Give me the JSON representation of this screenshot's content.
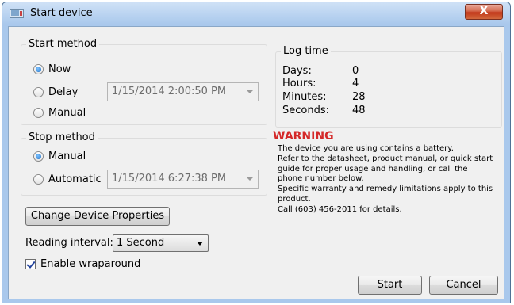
{
  "window": {
    "title": "Start device",
    "close_label": "X"
  },
  "start_method": {
    "group_title": "Start method",
    "now_label": "Now",
    "delay_label": "Delay",
    "manual_label": "Manual",
    "selected": "Now",
    "delay_datetime": "1/15/2014 2:00:50 PM"
  },
  "stop_method": {
    "group_title": "Stop method",
    "manual_label": "Manual",
    "automatic_label": "Automatic",
    "selected": "Manual",
    "automatic_datetime": "1/15/2014 6:27:38 PM"
  },
  "log_time": {
    "group_title": "Log time",
    "days_label": "Days:",
    "days_value": "0",
    "hours_label": "Hours:",
    "hours_value": "4",
    "minutes_label": "Minutes:",
    "minutes_value": "28",
    "seconds_label": "Seconds:",
    "seconds_value": "48"
  },
  "warning": {
    "title": "WARNING",
    "lines": [
      "The device you are using contains a battery.",
      "Refer to the datasheet, product manual, or quick start",
      "guide for proper usage and handling, or call the",
      "phone number below.",
      "Specific warranty and remedy limitations apply to this",
      "product.",
      "Call (603) 456-2011 for details."
    ]
  },
  "change_properties_label": "Change Device Properties",
  "reading_interval": {
    "label": "Reading interval:",
    "value": "1 Second"
  },
  "enable_wraparound": {
    "label": "Enable wraparound",
    "checked": true
  },
  "buttons": {
    "start_label": "Start",
    "cancel_label": "Cancel"
  },
  "colors": {
    "warning": "#d42828",
    "title_bar": "#a9c8ec",
    "client": "#f0f0f0"
  }
}
